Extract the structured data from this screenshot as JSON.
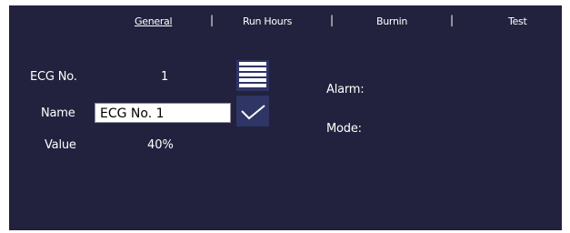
{
  "tabs": [
    {
      "label": "General",
      "active": true
    },
    {
      "label": "Run Hours",
      "active": false
    },
    {
      "label": "Burnin",
      "active": false
    },
    {
      "label": "Test",
      "active": false
    }
  ],
  "tab_separator": "|",
  "fields": {
    "ecg_no_label": "ECG No.",
    "ecg_no_value": "1",
    "name_label": "Name",
    "name_value": "ECG No. 1",
    "value_label": "Value",
    "value_value": "40%"
  },
  "status": {
    "alarm_label": "Alarm:",
    "mode_label": "Mode:"
  },
  "icons": {
    "menu": "hamburger-menu-icon",
    "confirm": "checkmark-icon"
  },
  "colors": {
    "panel_background": "#22223e",
    "button_background": "#2f3564",
    "text": "#ffffff"
  }
}
